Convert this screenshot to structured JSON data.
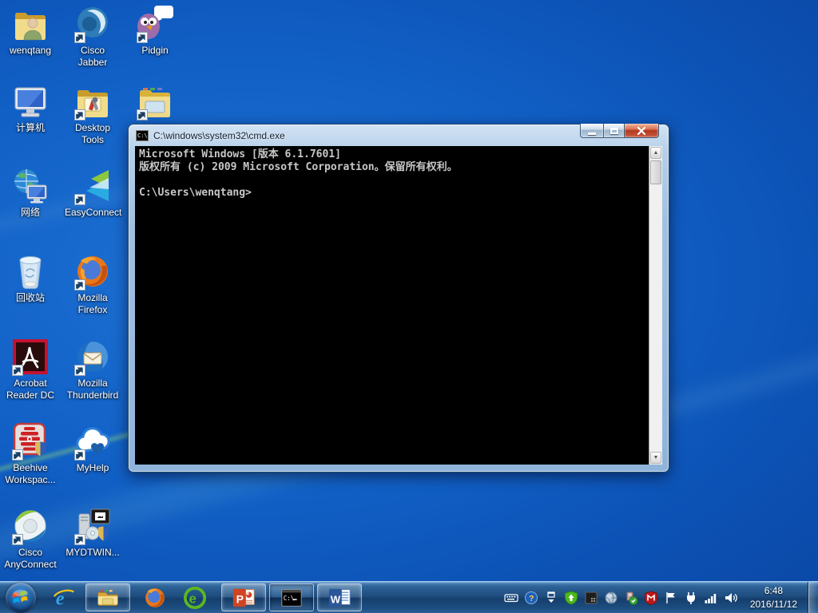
{
  "desktop_icons": [
    {
      "id": "wenqtang",
      "label1": "wenqtang",
      "label2": ""
    },
    {
      "id": "cisco-jabber",
      "label1": "Cisco",
      "label2": "Jabber"
    },
    {
      "id": "pidgin",
      "label1": "Pidgin",
      "label2": ""
    },
    {
      "id": "computer",
      "label1": "计算机",
      "label2": ""
    },
    {
      "id": "desktop-tools",
      "label1": "Desktop",
      "label2": "Tools"
    },
    {
      "id": "network",
      "label1": "网络",
      "label2": ""
    },
    {
      "id": "easyconnect",
      "label1": "EasyConnect",
      "label2": ""
    },
    {
      "id": "recycle-bin",
      "label1": "回收站",
      "label2": ""
    },
    {
      "id": "firefox",
      "label1": "Mozilla",
      "label2": "Firefox"
    },
    {
      "id": "acrobat",
      "label1": "Acrobat",
      "label2": "Reader DC"
    },
    {
      "id": "thunderbird",
      "label1": "Mozilla",
      "label2": "Thunderbird"
    },
    {
      "id": "beehive",
      "label1": "Beehive",
      "label2": "Workspac..."
    },
    {
      "id": "myhelp",
      "label1": "MyHelp",
      "label2": ""
    },
    {
      "id": "anyconnect",
      "label1": "Cisco",
      "label2": "AnyConnect"
    },
    {
      "id": "mydtwin",
      "label1": "MYDTWIN...",
      "label2": ""
    }
  ],
  "cmd_window": {
    "title": "C:\\windows\\system32\\cmd.exe",
    "title_icon_glyph": "C:\\",
    "console_lines": [
      "Microsoft Windows [版本 6.1.7601]",
      "版权所有 (c) 2009 Microsoft Corporation。保留所有权利。",
      "",
      "C:\\Users\\wenqtang>"
    ]
  },
  "taskbar_glyphs": {
    "ie": "e",
    "browser360": "e",
    "powerpoint": "P",
    "word": "W",
    "cmd_icon_text": "C:\\"
  },
  "tray": {
    "mcafee_glyph": "M",
    "help_glyph": "?",
    "time": "6:48",
    "date": "2016/11/12"
  },
  "colors": {
    "wallpaper_blue": "#1160c6",
    "taskbar_blue": "#1d4b7e",
    "close_red": "#b13a22",
    "console_black": "#000000",
    "console_text": "#c8c8c8"
  }
}
